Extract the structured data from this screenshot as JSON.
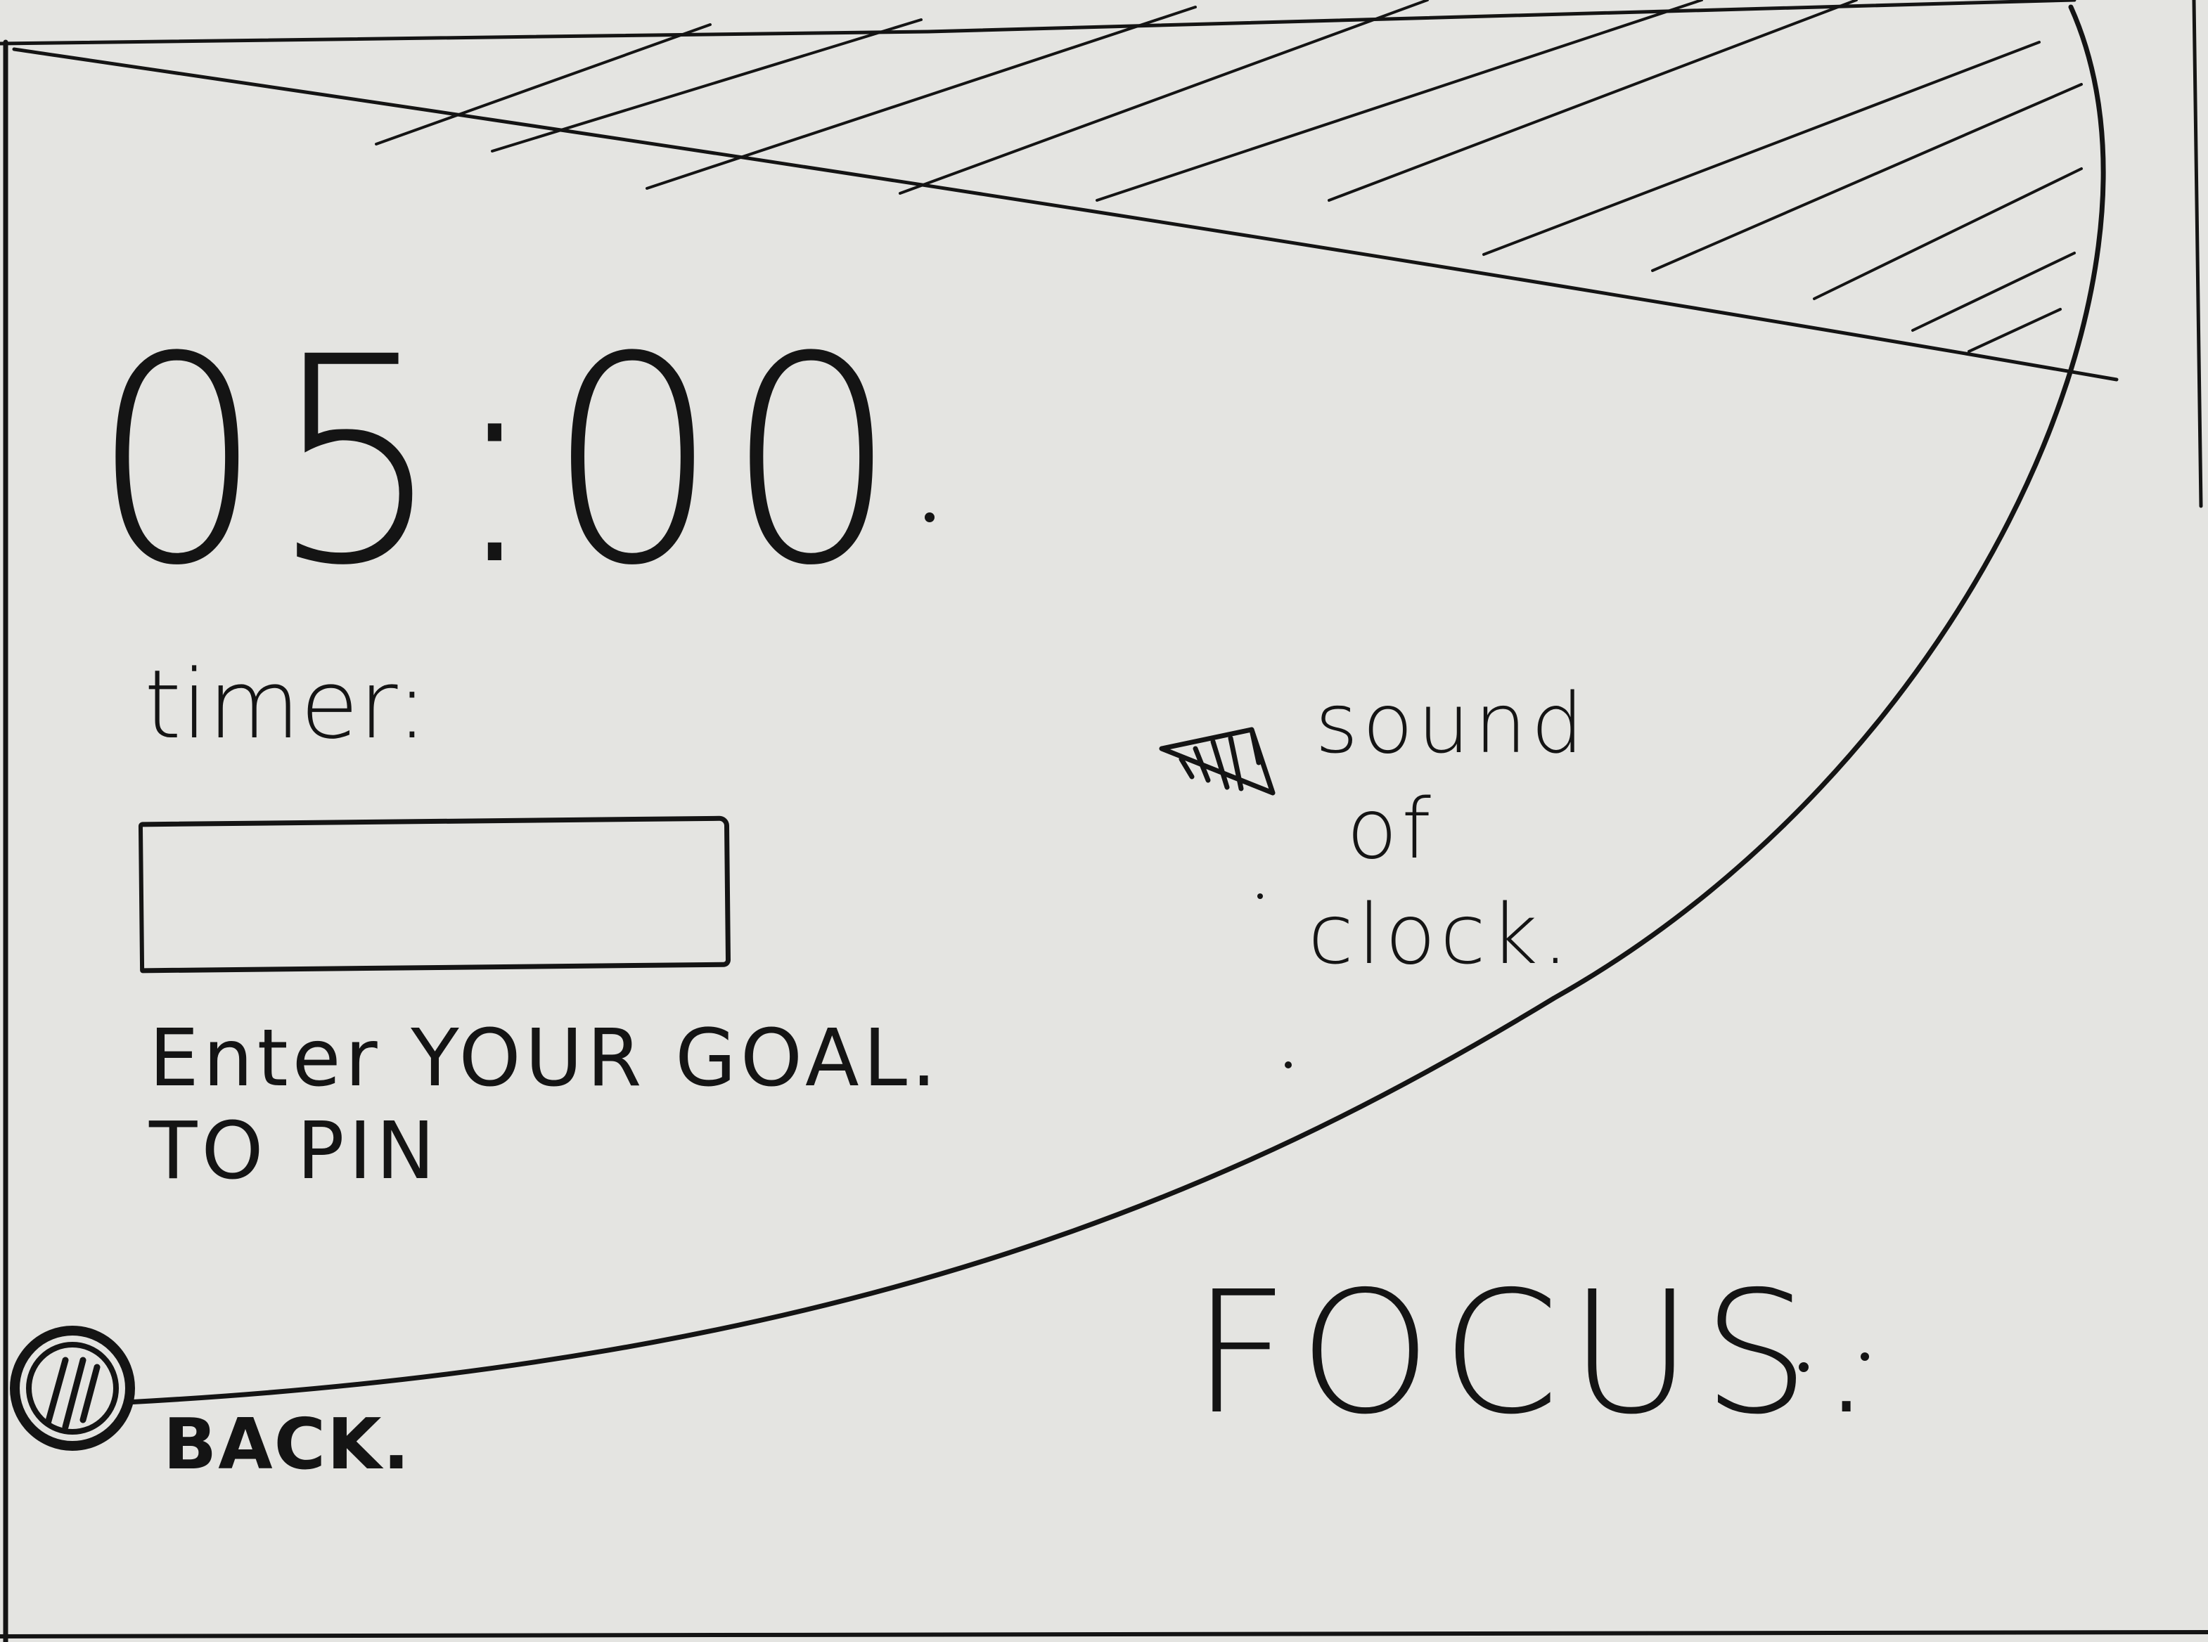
{
  "timer": {
    "display": "05:00",
    "label": "timer:"
  },
  "goal": {
    "value": "",
    "placeholder": "",
    "hint_line1": "Enter YOUR GOAL.",
    "hint_line2": "TO PIN"
  },
  "sound": {
    "icon": "speaker-icon",
    "label_line1": "sound",
    "label_line2": "of",
    "label_line3": "clock."
  },
  "page": {
    "title": "FOCUS."
  },
  "navigation": {
    "back_icon": "back-circle-icon",
    "back_label": "BACK."
  },
  "colors": {
    "ink": "#141414",
    "paper": "#e4e4e1"
  }
}
